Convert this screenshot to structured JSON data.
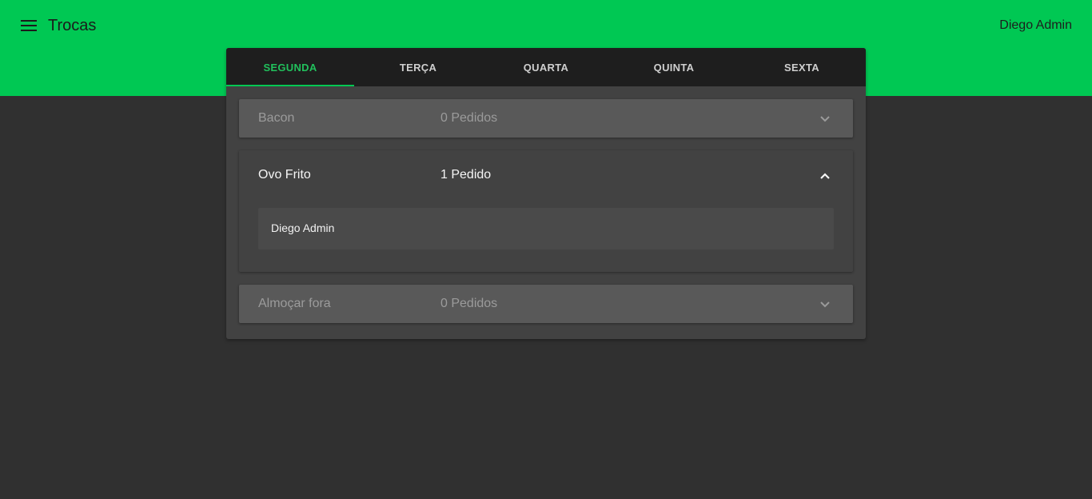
{
  "appbar": {
    "title": "Trocas",
    "user": "Diego Admin",
    "menu_icon": "menu-icon",
    "color": "#00c853"
  },
  "tabs": [
    {
      "label": "SEGUNDA",
      "active": true
    },
    {
      "label": "TERÇA",
      "active": false
    },
    {
      "label": "QUARTA",
      "active": false
    },
    {
      "label": "QUINTA",
      "active": false
    },
    {
      "label": "SEXTA",
      "active": false
    }
  ],
  "items": [
    {
      "name": "Bacon",
      "count": "0 Pedidos",
      "expanded": false,
      "icon": "chevron-down-icon"
    },
    {
      "name": "Ovo Frito",
      "count": "1 Pedido",
      "expanded": true,
      "icon": "chevron-up-icon",
      "orders": [
        "Diego Admin"
      ]
    },
    {
      "name": "Almoçar fora",
      "count": "0 Pedidos",
      "expanded": false,
      "icon": "chevron-down-icon"
    }
  ],
  "colors": {
    "accent": "#00c853",
    "background": "#303030",
    "card": "#424242",
    "tabbar": "#1e1e1e"
  }
}
